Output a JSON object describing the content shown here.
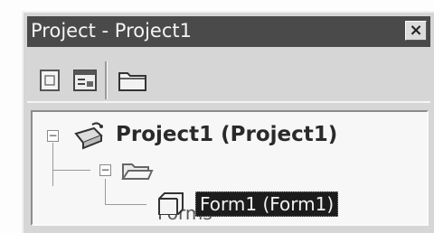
{
  "window": {
    "title": "Project - Project1",
    "close_glyph": "×"
  },
  "toolbar": {
    "buttons": [
      {
        "name": "view-code",
        "icon": "view-code-icon"
      },
      {
        "name": "view-object",
        "icon": "view-object-icon"
      },
      {
        "name": "toggle-folders",
        "icon": "folder-icon"
      }
    ]
  },
  "tree": {
    "project": {
      "label": "Project1 (Project1)",
      "icon": "project-icon",
      "expanded": true
    },
    "forms_folder": {
      "label": "Forms",
      "icon": "open-folder-icon",
      "expanded": true
    },
    "form": {
      "label": "Form1 (Form1)",
      "icon": "form-icon",
      "selected": true
    }
  },
  "colors": {
    "titlebar": "#4a4a4a",
    "selection": "#1c1c1c",
    "window_bg": "#d6d6d6",
    "tree_bg": "#f7f7f7"
  }
}
